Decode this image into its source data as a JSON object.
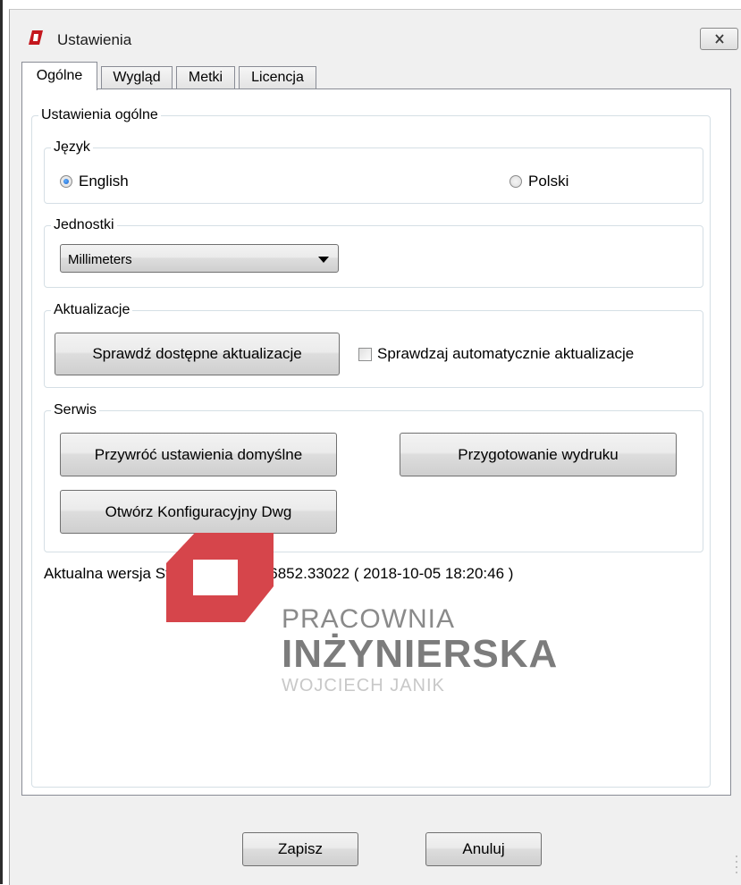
{
  "window": {
    "title": "Ustawienia",
    "accent_color": "#c4171d"
  },
  "tabs": [
    {
      "label": "Ogólne",
      "active": true
    },
    {
      "label": "Wygląd",
      "active": false
    },
    {
      "label": "Metki",
      "active": false
    },
    {
      "label": "Licencja",
      "active": false
    }
  ],
  "general": {
    "group_label": "Ustawienia ogólne",
    "language": {
      "label": "Język",
      "options": [
        {
          "label": "English",
          "checked": true
        },
        {
          "label": "Polski",
          "checked": false
        }
      ]
    },
    "units": {
      "label": "Jednostki",
      "selected": "Millimeters"
    },
    "updates": {
      "label": "Aktualizacje",
      "check_button": "Sprawdź dostępne aktualizacje",
      "auto_check_label": "Sprawdzaj automatycznie aktualizacje",
      "auto_check_checked": false
    },
    "service": {
      "label": "Serwis",
      "restore_button": "Przywróć ustawienia domyślne",
      "print_prep_button": "Przygotowanie wydruku",
      "open_config_button": "Otwórz Konfiguracyjny Dwg"
    },
    "version_text": "Aktualna wersja StropyCAD : 2.9.6852.33022 ( 2018-10-05 18:20:46 )"
  },
  "logo": {
    "line1": "PRACOWNIA",
    "line2": "INŻYNIERSKA",
    "line3": "WOJCIECH JANIK",
    "color": "#d6454b"
  },
  "footer": {
    "save_button": "Zapisz",
    "cancel_button": "Anuluj"
  }
}
